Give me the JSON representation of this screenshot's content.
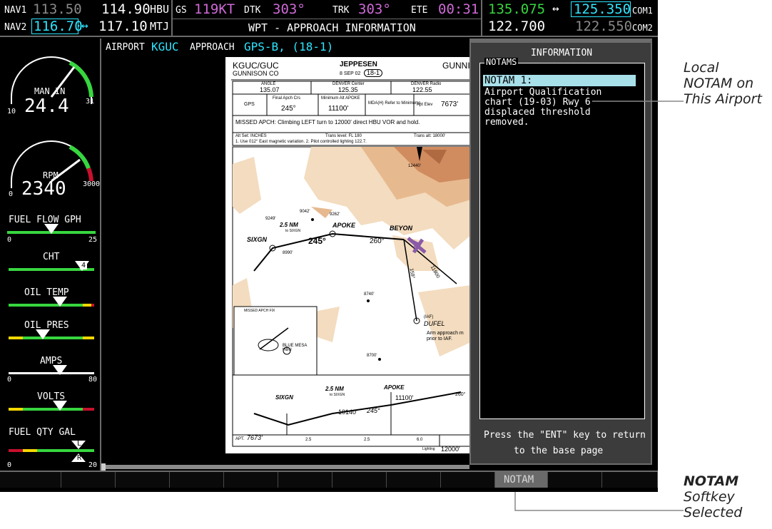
{
  "nav": {
    "nav1_label": "NAV1",
    "nav1_stby": "113.50",
    "nav1_active": "114.90",
    "nav1_id": "HBU",
    "nav2_label": "NAV2",
    "nav2_stby": "116.70",
    "nav2_active": "117.10",
    "nav2_id": "MTJ",
    "swap": "↔"
  },
  "data_bar": {
    "gs_label": "GS",
    "gs_value": "119KT",
    "dtk_label": "DTK",
    "dtk_value": "303°",
    "trk_label": "TRK",
    "trk_value": "303°",
    "ete_label": "ETE",
    "ete_value": "00:31"
  },
  "page_title": "WPT - APPROACH INFORMATION",
  "com": {
    "com1_active": "135.075",
    "com1_stby": "125.350",
    "com1_label": "COM1",
    "com2_active": "122.700",
    "com2_stby": "122.550",
    "com2_label": "COM2",
    "swap": "↔"
  },
  "eis": {
    "man_in": {
      "label": "MAN IN",
      "value": "24.4",
      "min": "10",
      "max": "31",
      "level": 0.62
    },
    "rpm": {
      "label": "RPM",
      "value": "2340",
      "min": "0",
      "max": "3000",
      "level": 0.78
    },
    "fuel_flow": {
      "label": "FUEL FLOW GPH",
      "min": "0",
      "max": "25",
      "level": 0.5
    },
    "cht": {
      "label": "CHT",
      "badge": "4",
      "level": 0.86
    },
    "oil_temp": {
      "label": "OIL TEMP",
      "level": 0.6
    },
    "oil_pres": {
      "label": "OIL PRES",
      "level": 0.4
    },
    "amps": {
      "label": "AMPS",
      "min": "0",
      "max": "80",
      "level": 0.6
    },
    "volts": {
      "label": "VOLTS",
      "level": 0.6
    },
    "fuel_qty": {
      "label": "FUEL QTY GAL",
      "min": "0",
      "max": "20",
      "left_tag": "L",
      "right_tag": "R",
      "level": 0.82
    }
  },
  "approach_bar": {
    "airport_label": "AIRPORT",
    "airport_value": "KGUC",
    "approach_label": "APPROACH",
    "approach_value": "GPS-B, (18-1)"
  },
  "chart": {
    "ident": "KGUC/GUC",
    "city": "GUNNISON CO",
    "brand": "JEPPESEN",
    "date": "8 SEP 02",
    "chart_no": "18-1",
    "place_right": "GUNNI",
    "freq1_label": "ANGLE",
    "freq1": "135.07",
    "freq2_label": "DENVER Center",
    "freq2": "125.35",
    "freq3_label": "DENVER Radio",
    "freq3": "122.55",
    "row2_a": "GPS",
    "row2_b_label": "Final Apch Crs",
    "row2_b": "245°",
    "row2_c_label": "Minimum Alt APOKE",
    "row2_c": "11100'",
    "row2_d_label": "MDA(H) Refer to Minimums",
    "row2_e_label": "Apt Elev",
    "row2_e": "7673'",
    "missed": "MISSED APCH: Climbing LEFT turn to 12000' direct HBU VOR and hold.",
    "altset": "Alt Set: INCHES",
    "trans_level": "Trans level: FL 180",
    "trans_alt": "Trans alt: 18000'",
    "notes": "1. Use 012° East magnetic variation. 2. Pilot controlled lighting 122.7.",
    "wp_sixgn": "SIXGN",
    "wp_apoke": "APOKE",
    "wp_beyon": "BEYON",
    "wp_dufel": "DUFEL",
    "dufel_tag": "(IAF)",
    "dist1": "2.5 NM",
    "dist1_sub": "to SIXGN",
    "crs": "245°",
    "crs2": "260°",
    "crs3": "159°",
    "crs4": "11800",
    "alt12440": "12440'",
    "alt9262": "9262'",
    "alt9249": "9249'",
    "alt9042": "9042'",
    "alt8990": "8990'",
    "alt8740": "8740'",
    "alt8700": "8700'",
    "inset_title": "MISSED APCH FIX",
    "inset_label": "BLUE MESA HBU",
    "arm_note": "Arm approach m prior to IAF.",
    "prof_sixgn": "SIXGN",
    "prof_apoke": "APOKE",
    "prof_dist": "2.5 NM",
    "prof_dist_sub": "to SIXGN",
    "prof_alt1": "10140'",
    "prof_alt2": "11100'",
    "prof_crs": "245°",
    "prof_crs2": "260°",
    "apt_label": "APT.",
    "apt_elev": "7673'",
    "scale_a": "2.5",
    "scale_b": "2.5",
    "scale_c": "6.0",
    "lighting": "Lighting",
    "last_alt": "12000'"
  },
  "info": {
    "title": "INFORMATION",
    "notams_label": "NOTAMS",
    "notam_head": "NOTAM 1:",
    "notam_lines": [
      "Airport Qualification",
      "chart (19-03) Rwy 6",
      "displaced threshold",
      "removed."
    ],
    "footer1": "Press the \"ENT\" key to return",
    "footer2": "to the base page"
  },
  "softkeys": {
    "notam": "NOTAM"
  },
  "callouts": {
    "notam_local_1": "Local",
    "notam_local_2": "NOTAM on",
    "notam_local_3": "This Airport",
    "softkey_1": "NOTAM",
    "softkey_2": "Softkey",
    "softkey_3": "Selected"
  },
  "colors": {
    "cyan": "#2ee6ff",
    "magenta": "#d06ad8",
    "green": "#37d63f",
    "highlight": "#a8e0ea"
  }
}
